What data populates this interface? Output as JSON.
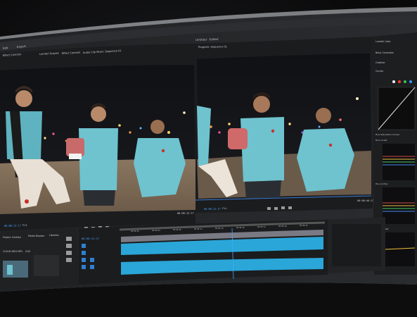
{
  "app": {
    "source_tabs": [
      "Effect Controls",
      "Lumetri Scopes",
      "Effect Controls",
      "Audio Clip Mixer: Sequence 01"
    ],
    "program_title": "Program: Sequence 01",
    "source_timecode": "00:00:12:17",
    "program_timecode": "00:00:12:17",
    "program_duration": "00:00:46:23",
    "source_fit": "Fit",
    "program_fit": "Fit",
    "timeline_timecode": "00:00:12:17",
    "lumetri": {
      "title": "Lumetri Color",
      "sections": [
        "Basic Correction",
        "Creative",
        "Curves",
        "Color Wheels & Match",
        "HSL Secondary"
      ],
      "scopes": [
        "Hue Saturation Curves",
        "Hue vs Sat",
        "Hue vs Hue",
        "Luma vs Sat"
      ]
    },
    "project": {
      "title": "Project: Untitled",
      "tabs": [
        "Media Browser",
        "Libraries"
      ],
      "clip_name": "CLOUD 5804 MP4",
      "clip_duration": "0:00"
    }
  },
  "colors": {
    "ui_bg": "#242628",
    "panel_bg": "#1b1c1e",
    "accent": "#2f9bff",
    "clip": "#2aa6d8"
  }
}
